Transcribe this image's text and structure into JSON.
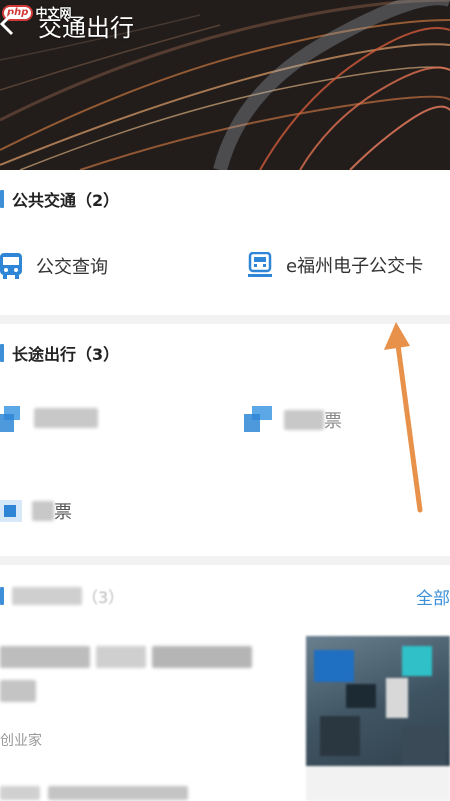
{
  "header": {
    "watermark_logo": "php",
    "watermark_text": "中文网",
    "title": "交通出行",
    "back_icon": "chevron-left-icon"
  },
  "public_transport": {
    "title": "公共交通（2）",
    "items": [
      {
        "label": "公交查询",
        "icon": "bus-icon"
      },
      {
        "label": "e福州电子公交卡",
        "icon": "bus-card-icon"
      }
    ]
  },
  "long_distance": {
    "title": "长途出行（3）",
    "items": [
      {
        "label_visible": "",
        "icon": "flight-icon"
      },
      {
        "label_visible": "票",
        "icon": "train-icon"
      },
      {
        "label_visible": "票",
        "icon": "ticket-icon"
      }
    ]
  },
  "news": {
    "title_visible": "（3）",
    "all_link": "全部",
    "source_visible": "创业家"
  },
  "colors": {
    "accent": "#3d8fd8",
    "annotation_arrow": "#e8914a"
  }
}
